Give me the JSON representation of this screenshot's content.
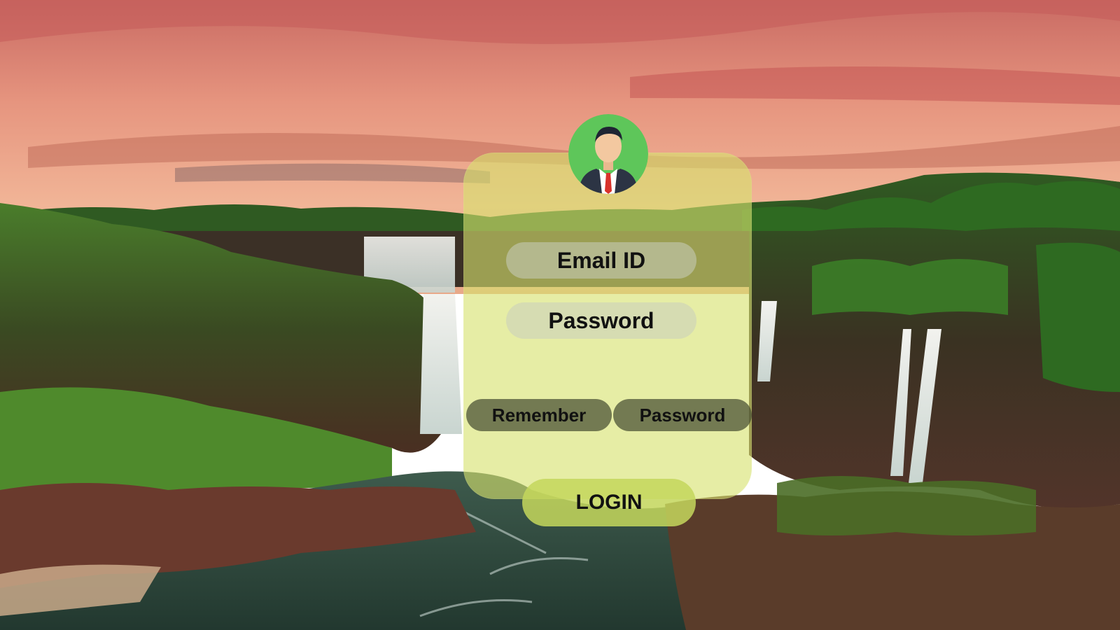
{
  "form": {
    "email_placeholder": "Email ID",
    "password_placeholder": "Password",
    "remember_label": "Remember",
    "forgot_password_label": "Password",
    "login_label": "LOGIN"
  },
  "avatar": {
    "icon": "user-avatar-icon"
  },
  "colors": {
    "card": "#d6e26e",
    "avatar_bg": "#5ec65a",
    "login_bg": "#c4d65c",
    "sky_top": "#d87a6a",
    "sky_bottom": "#f0b39a",
    "jungle": "#3f7a2a"
  }
}
